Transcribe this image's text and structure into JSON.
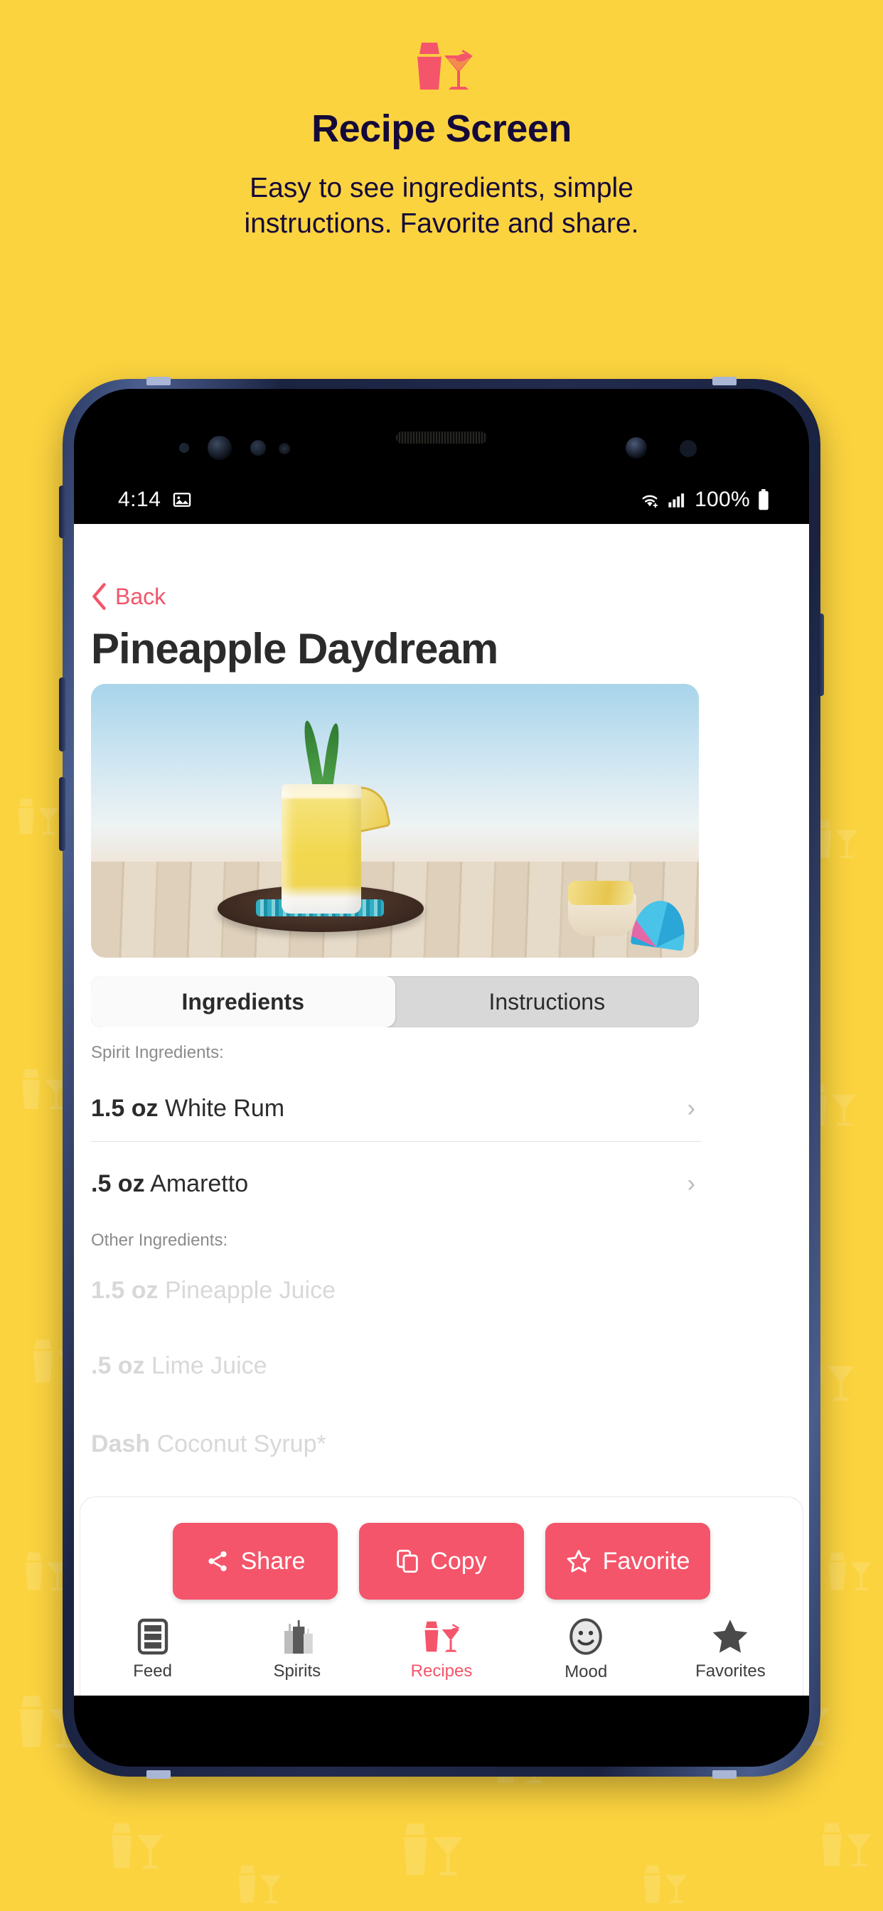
{
  "promo": {
    "logo_icon": "cocktail-shaker-martini-logo",
    "title": "Recipe Screen",
    "subtitle_line1": "Easy to see ingredients, simple",
    "subtitle_line2": "instructions. Favorite and share."
  },
  "colors": {
    "background": "#fbd33f",
    "accent": "#f4556a",
    "title_text": "#15093a",
    "phone_frame": "#2b3a63"
  },
  "status_bar": {
    "time": "4:14",
    "left_icons": [
      "image-icon"
    ],
    "right_icons": [
      "wifi-icon",
      "signal-icon",
      "battery-icon"
    ],
    "battery_percent": "100%"
  },
  "app": {
    "back_button": {
      "label": "Back",
      "icon": "chevron-left-icon"
    },
    "recipe_title": "Pineapple Daydream",
    "hero_image_alt": "pineapple cocktail on wooden plate at the beach",
    "tabs": [
      {
        "label": "Ingredients",
        "active": true
      },
      {
        "label": "Instructions",
        "active": false
      }
    ],
    "sections": [
      {
        "label": "Spirit Ingredients:",
        "items": [
          {
            "amount": "1.5 oz",
            "name": "White Rum",
            "chevron": "chevron-right-icon",
            "faded": false
          },
          {
            "amount": ".5 oz",
            "name": "Amaretto",
            "chevron": "chevron-right-icon",
            "faded": false
          }
        ]
      },
      {
        "label": "Other Ingredients:",
        "items": [
          {
            "amount": "1.5 oz",
            "name": "Pineapple Juice",
            "chevron": "chevron-right-icon",
            "faded": true
          },
          {
            "amount": ".5 oz",
            "name": "Lime Juice",
            "chevron": "chevron-right-icon",
            "faded": true
          },
          {
            "amount": "Dash",
            "name": "Coconut Syrup*",
            "chevron": "chevron-right-icon",
            "faded": true
          }
        ]
      }
    ],
    "actions": [
      {
        "label": "Share",
        "icon": "share-icon"
      },
      {
        "label": "Copy",
        "icon": "copy-icon"
      },
      {
        "label": "Favorite",
        "icon": "star-outline-icon"
      }
    ],
    "bottom_nav": [
      {
        "label": "Feed",
        "icon": "feed-icon",
        "active": false
      },
      {
        "label": "Spirits",
        "icon": "bottles-icon",
        "active": false
      },
      {
        "label": "Recipes",
        "icon": "shaker-martini-icon",
        "active": true
      },
      {
        "label": "Mood",
        "icon": "smiley-icon",
        "active": false
      },
      {
        "label": "Favorites",
        "icon": "star-filled-icon",
        "active": false
      }
    ]
  }
}
